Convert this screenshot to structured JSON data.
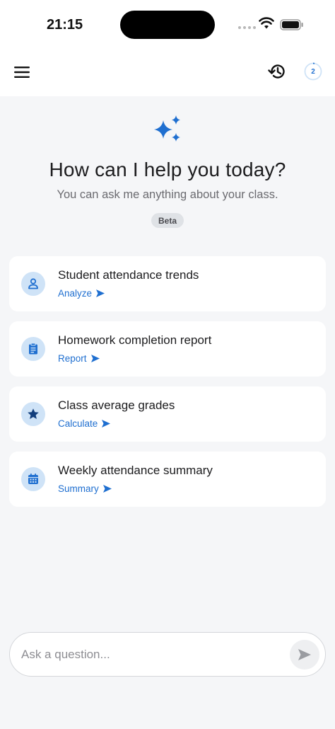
{
  "status_bar": {
    "time": "21:15"
  },
  "header": {
    "usage_count": "2"
  },
  "hero": {
    "title": "How can I help you today?",
    "subtitle": "You can ask me anything about your class.",
    "badge": "Beta"
  },
  "suggestions": [
    {
      "title": "Student attendance trends",
      "action": "Analyze",
      "icon": "person-icon"
    },
    {
      "title": "Homework completion report",
      "action": "Report",
      "icon": "clipboard-icon"
    },
    {
      "title": "Class average grades",
      "action": "Calculate",
      "icon": "star-icon"
    },
    {
      "title": "Weekly attendance summary",
      "action": "Summary",
      "icon": "calendar-icon"
    }
  ],
  "composer": {
    "placeholder": "Ask a question..."
  },
  "colors": {
    "accent": "#1f6fd0",
    "icon_bg": "#cfe3f7",
    "background": "#f5f6f8"
  }
}
